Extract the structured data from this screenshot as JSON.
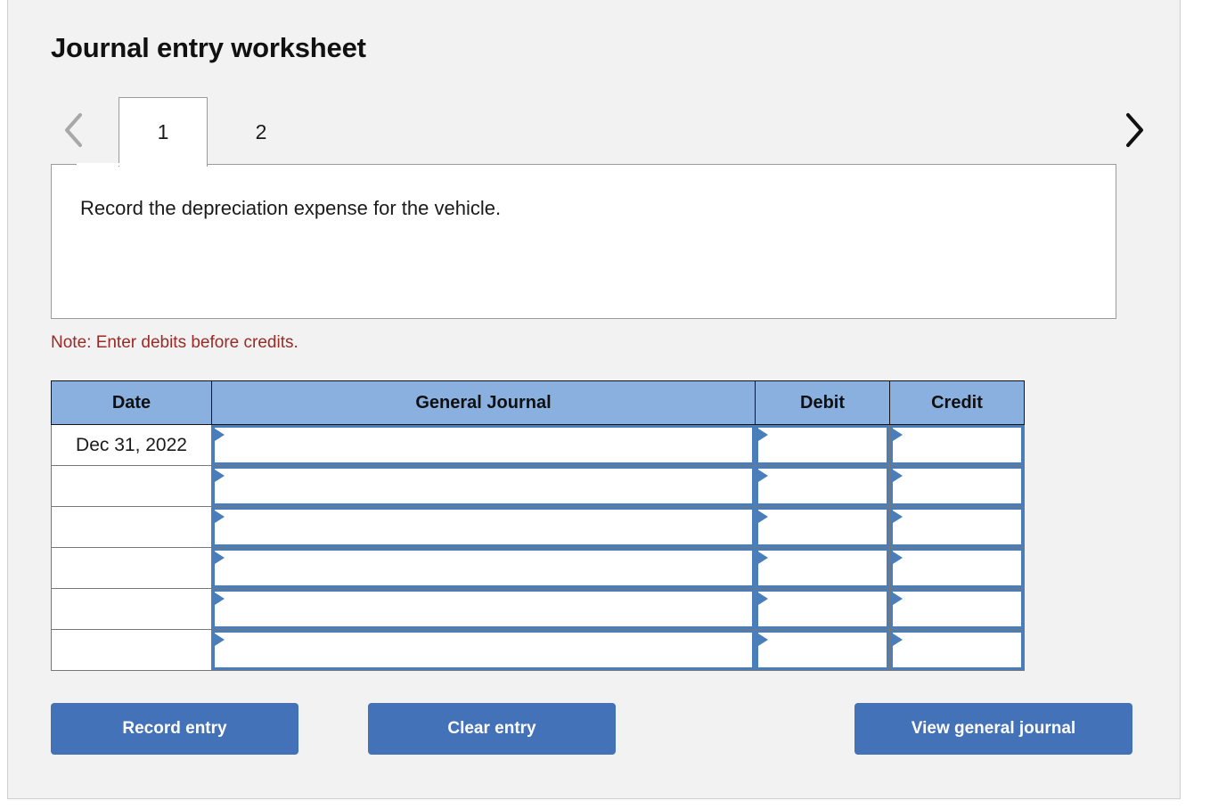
{
  "page": {
    "title": "Journal entry worksheet"
  },
  "tabs": {
    "prev_icon": "chevron-left-icon",
    "next_icon": "chevron-right-icon",
    "items": [
      {
        "label": "1",
        "active": true
      },
      {
        "label": "2",
        "active": false
      }
    ]
  },
  "description": {
    "text": "Record the depreciation expense for the vehicle."
  },
  "note": {
    "text": "Note: Enter debits before credits.",
    "color": "#9a2a25"
  },
  "table": {
    "headers": [
      "Date",
      "General Journal",
      "Debit",
      "Credit"
    ],
    "header_bg": "#8ab0e0",
    "input_border": "#4a7ebb",
    "rows": [
      {
        "date": "Dec 31, 2022",
        "general_journal": "",
        "debit": "",
        "credit": ""
      },
      {
        "date": "",
        "general_journal": "",
        "debit": "",
        "credit": ""
      },
      {
        "date": "",
        "general_journal": "",
        "debit": "",
        "credit": ""
      },
      {
        "date": "",
        "general_journal": "",
        "debit": "",
        "credit": ""
      },
      {
        "date": "",
        "general_journal": "",
        "debit": "",
        "credit": ""
      },
      {
        "date": "",
        "general_journal": "",
        "debit": "",
        "credit": ""
      }
    ]
  },
  "buttons": {
    "record": "Record entry",
    "clear": "Clear entry",
    "view": "View general journal",
    "bg": "#4472b8"
  }
}
